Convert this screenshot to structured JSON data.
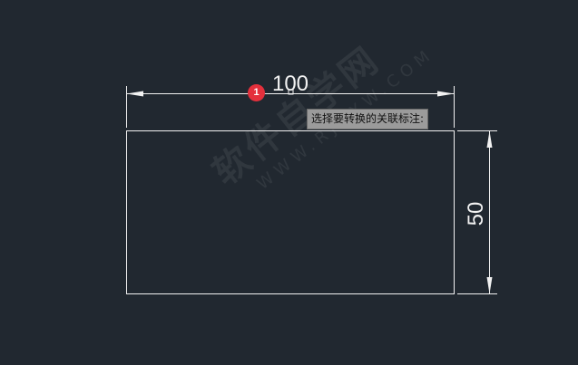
{
  "drawing": {
    "horizontal_dimension": "100",
    "vertical_dimension": "50"
  },
  "badge": {
    "number": "1",
    "color": "#e4303c"
  },
  "prompt": {
    "text": "选择要转换的关联标注:"
  },
  "watermark": {
    "main": "软件自学网",
    "sub": "WWW.RJZXW.COM"
  },
  "colors": {
    "background": "#212830",
    "lines": "#f2f2f2",
    "tooltip_bg": "#9b9b9b"
  }
}
